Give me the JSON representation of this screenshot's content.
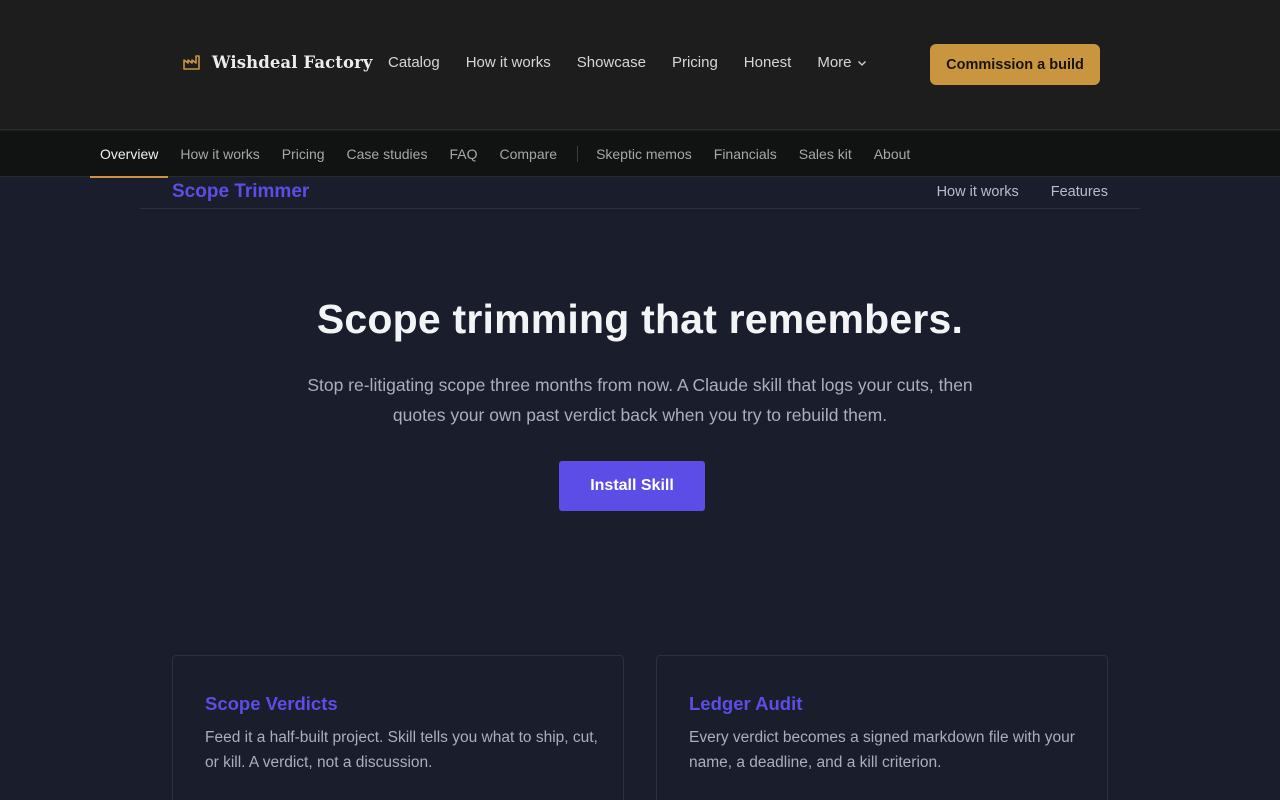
{
  "header": {
    "brand_name": "Wishdeal Factory",
    "brand_icon": "factory-icon",
    "nav": [
      {
        "label": "Catalog"
      },
      {
        "label": "How it works"
      },
      {
        "label": "Showcase"
      },
      {
        "label": "Pricing"
      },
      {
        "label": "Honest"
      },
      {
        "label": "More"
      }
    ],
    "cta_label": "Commission a build"
  },
  "subnav": {
    "group1": [
      {
        "label": "Overview",
        "active": true
      },
      {
        "label": "How it works"
      },
      {
        "label": "Pricing"
      },
      {
        "label": "Case studies"
      },
      {
        "label": "FAQ"
      },
      {
        "label": "Compare"
      }
    ],
    "group2": [
      {
        "label": "Skeptic memos"
      },
      {
        "label": "Financials"
      },
      {
        "label": "Sales kit"
      },
      {
        "label": "About"
      }
    ]
  },
  "product": {
    "name": "Scope Trimmer",
    "links": [
      {
        "label": "How it works"
      },
      {
        "label": "Features"
      }
    ]
  },
  "hero": {
    "title": "Scope trimming that remembers.",
    "subtitle": "Stop re-litigating scope three months from now. A Claude skill that logs your cuts, then quotes your own past verdict back when you try to rebuild them.",
    "button_label": "Install Skill"
  },
  "cards": [
    {
      "title": "Scope Verdicts",
      "text": "Feed it a half-built project. Skill tells you what to ship, cut, or kill. A verdict, not a discussion."
    },
    {
      "title": "Ledger Audit",
      "text": "Every verdict becomes a signed markdown file with your name, a deadline, and a kill criterion."
    }
  ],
  "colors": {
    "accent_gold": "#c9953f",
    "accent_purple": "#5b4de6",
    "page_bg": "#1a1e2c",
    "header_bg": "#1c1d1c"
  }
}
